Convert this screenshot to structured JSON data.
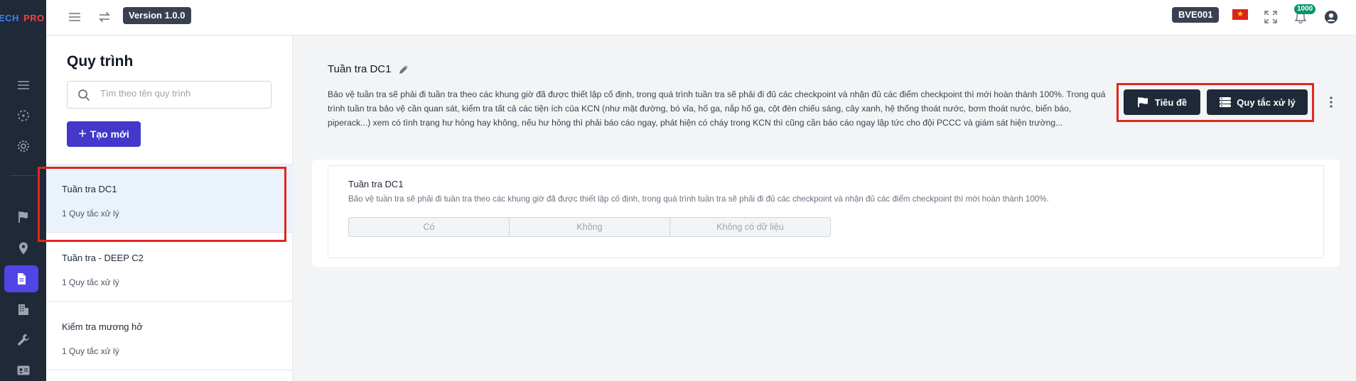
{
  "app": {
    "logo_left": "ECH",
    "logo_right": "PRO"
  },
  "header": {
    "version": "Version 1.0.0",
    "site_code": "BVE001",
    "notification_count": "1000",
    "icons": [
      "menu-icon",
      "swap-icon",
      "vietnam-flag-icon",
      "fullscreen-icon",
      "bell-icon",
      "user-avatar-icon"
    ]
  },
  "rail": {
    "icons": [
      "menu-lines-icon",
      "scan-target-icon",
      "gear-icon",
      "flag-icon",
      "map-pin-icon",
      "document-icon",
      "building-icon",
      "wrench-icon",
      "id-card-icon"
    ],
    "active": "document-icon"
  },
  "list": {
    "title": "Quy trình",
    "search_placeholder": "Tìm theo tên quy trình",
    "create_label": "Tạo mới",
    "items": [
      {
        "name": "Tuần tra DC1",
        "sub": "1 Quy tắc xử lý",
        "active": true
      },
      {
        "name": "Tuần tra - DEEP C2",
        "sub": "1 Quy tắc xử lý",
        "active": false
      },
      {
        "name": "Kiểm tra mương hở",
        "sub": "1 Quy tắc xử lý",
        "active": false
      }
    ]
  },
  "detail": {
    "title": "Tuần tra DC1",
    "description": "Bảo vệ tuần tra sẽ phải đi tuần tra theo các khung giờ đã được thiết lập cố định, trong quá trình tuần tra sẽ phải đi đủ các checkpoint và nhận đủ các điểm checkpoint thì mới hoàn thành 100%. Trong quá trình tuần tra bảo vệ cần quan sát, kiểm tra tất cả các tiện ích của KCN (như mặt đường, bó vỉa, hố ga, nắp hố ga, cột đèn chiếu sáng, cây xanh, hệ thống thoát nước, bơm thoát nước, biển báo, piperack...) xem có tình trạng hư hỏng hay không, nếu hư hỏng thì phải báo cáo ngay, phát hiện có cháy trong KCN thì cũng cần báo cáo ngay lập tức cho đội PCCC và giám sát hiện trường...",
    "btn_title": "Tiêu đề",
    "btn_rules": "Quy tắc xử lý",
    "card": {
      "title": "Tuần tra DC1",
      "description": "Bảo vệ tuần tra sẽ phải đi tuần tra theo các khung giờ đã được thiết lập cố định, trong quá trình tuần tra sẽ phải đi đủ các checkpoint và nhận đủ các điểm checkpoint thì mới hoàn thành 100%.",
      "options": [
        "Có",
        "Không",
        "Không có dữ liệu"
      ]
    }
  }
}
